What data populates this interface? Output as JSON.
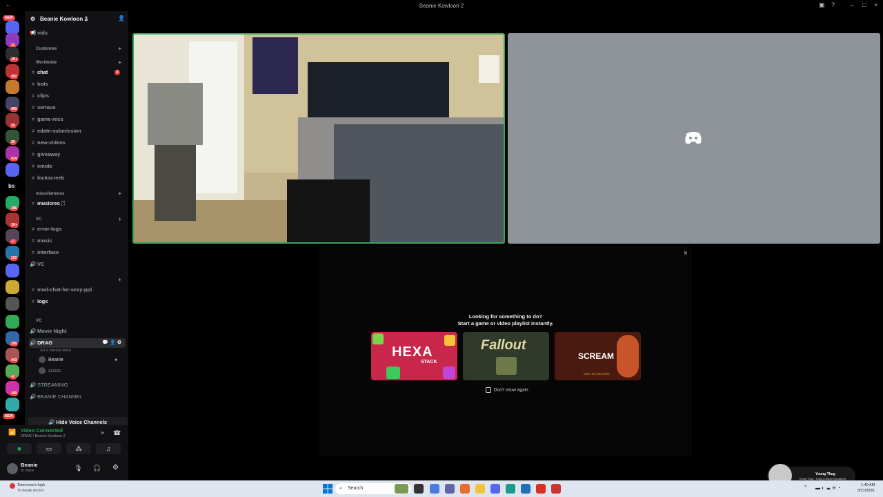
{
  "window": {
    "title": "Beanie Kowloon 2"
  },
  "server": {
    "name": "Beanie Kowloon 2"
  },
  "rail_badges": [
    "NEW",
    "11",
    "1K+",
    "497",
    "400",
    "25",
    "30",
    "414",
    "286",
    "1K+",
    "17",
    "167",
    "290",
    "443",
    "42",
    "169",
    "NEW"
  ],
  "rail_label_bs": "bs",
  "categories": {
    "customize": "Customize",
    "worldwide": "Worldwide",
    "miscellaneous": "miscellaneous",
    "vc1": "VC",
    "blank": "",
    "vc2": "VC"
  },
  "channels": {
    "vids": "vids",
    "chat": "chat",
    "chat_unread": "3",
    "bots": "bots",
    "clips": "clips",
    "serious": "serious",
    "game_recs": "game-recs",
    "edate": "edate-submission",
    "new_videos": "new-videos",
    "giveaway": "giveaway",
    "emote": "emote",
    "lockscreeb": "lockscreeb",
    "musicrec": "musicrec🎵",
    "error_logs": "error-logs",
    "music": "music",
    "interface": "interface",
    "vc": "VC",
    "mod_chat": "mod-chat-for-sexy-ppl",
    "logs": "logs",
    "movie_night": "Movie Night",
    "drag": "DRAG",
    "drag_status": "Set a channel status",
    "streaming": "STREAMING",
    "beanie_channel": "BEANIE CHANNEL"
  },
  "voice_users": [
    "Beanie",
    "zzzzzz"
  ],
  "hide_voice": "Hide Voice Channels",
  "voice_panel": {
    "status": "Video Connected",
    "location": "DRAG / Beanie Kowloon 2"
  },
  "user": {
    "name": "Beanie",
    "status": "In voice"
  },
  "activity": {
    "line1": "Looking for something to do?",
    "line2": "Start a game or video playlist instantly.",
    "games": [
      {
        "title": "HEXA",
        "subtitle": "STACK"
      },
      {
        "title": "Fallout",
        "subtitle": ""
      },
      {
        "title": "SCREAM",
        "subtitle": "ONLY IN THEATERS"
      }
    ],
    "dont_show": "Don't show again"
  },
  "taskbar": {
    "weather_line1": "Tomorrow's high",
    "weather_line2": "To break record",
    "search": "Search",
    "time": "1:40 AM",
    "date": "3/21/2026"
  },
  "now_playing": {
    "title": "Young Thug",
    "subtitle": "Young Thug - Ninja (Official Visualizer)"
  },
  "colors": {
    "accent_green": "#23a55a",
    "unread_red": "#f23f43",
    "stage_placeholder": "#8f949b"
  },
  "icons": [
    "discord-logo-icon",
    "camera-icon",
    "screen-share-icon",
    "activity-icon",
    "soundboard-icon",
    "mic-icon",
    "headphones-icon",
    "gear-icon",
    "windows-start-icon",
    "search-icon"
  ]
}
